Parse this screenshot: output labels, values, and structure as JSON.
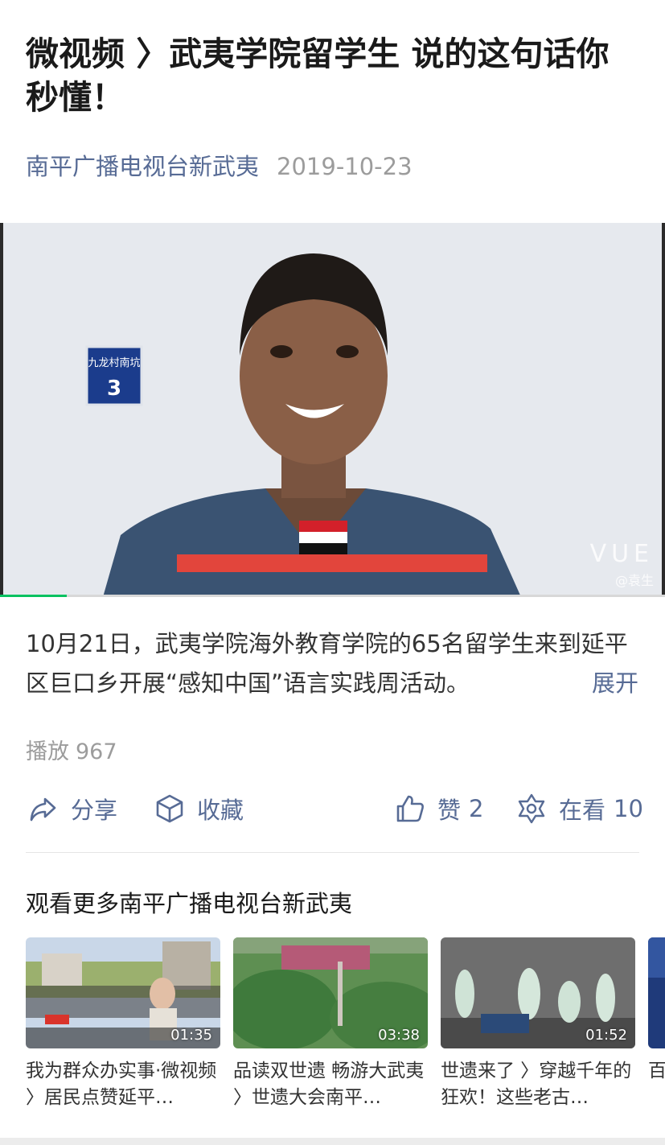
{
  "article": {
    "title": "微视频 〉武夷学院留学生 说的这句话你秒懂！",
    "account": "南平广播电视台新武夷",
    "date": "2019-10-23"
  },
  "video": {
    "sign_text": "九龙村南坑",
    "sign_number": "3",
    "watermark": "VUE",
    "credit": "@袁生",
    "progress": 0.1
  },
  "description": {
    "text": "10月21日，武夷学院海外教育学院的65名留学生来到延平区巨口乡开展“感知中国”语言实践周活动。",
    "expand_label": "展开"
  },
  "stats": {
    "play_label": "播放",
    "play_count": "967"
  },
  "actions": {
    "share_label": "分享",
    "favorite_label": "收藏",
    "like_label": "赞",
    "like_count": "2",
    "wow_label": "在看",
    "wow_count": "10"
  },
  "more": {
    "title": "观看更多南平广播电视台新武夷",
    "videos": [
      {
        "title": "我为群众办实事·微视频 〉居民点赞延平…",
        "duration": "01:35"
      },
      {
        "title": "品读双世遗 畅游大武夷 〉世遗大会南平…",
        "duration": "03:38"
      },
      {
        "title": "世遗来了 〉穿越千年的狂欢！这些老古…",
        "duration": "01:52"
      },
      {
        "title": "百《",
        "duration": ""
      }
    ]
  },
  "colors": {
    "link": "#576b95",
    "muted": "#9c9c9c",
    "progress": "#07c160"
  }
}
